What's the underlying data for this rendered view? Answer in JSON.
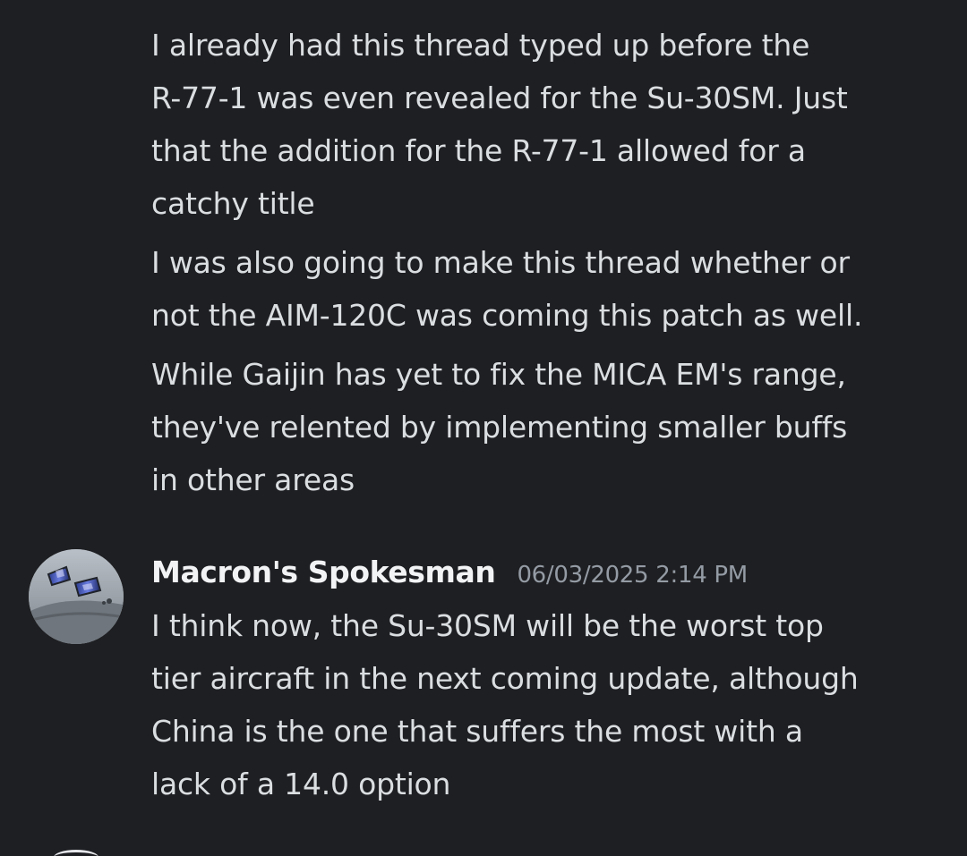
{
  "messages": [
    {
      "continuation": true,
      "paragraphs": [
        {
          "lines": [
            "I already had this thread typed up before the",
            "R-77-1 was even revealed for the Su-30SM. Just",
            "that the addition for the R-77-1 allowed for a",
            "catchy title"
          ]
        },
        {
          "lines": [
            "I was also going to make this thread whether or",
            "not the AIM-120C was coming this patch as well."
          ]
        },
        {
          "lines": [
            "While Gaijin has yet to fix the MICA EM's range,",
            "they've relented by implementing smaller buffs",
            "in other areas"
          ]
        }
      ]
    },
    {
      "username": "Macron's Spokesman",
      "timestamp": "06/03/2025 2:14 PM",
      "avatar_icon": "jet-cockpit-avatar",
      "lines": [
        "I think now, the Su-30SM will be the worst top",
        "tier aircraft in the next coming update, although",
        "China is the one that suffers the most with a",
        "lack of a 14.0 option"
      ]
    }
  ],
  "colors": {
    "background": "#1e1f22",
    "message_text": "#dbdee1",
    "username": "#f2f3f5",
    "timestamp": "#949ba4"
  }
}
